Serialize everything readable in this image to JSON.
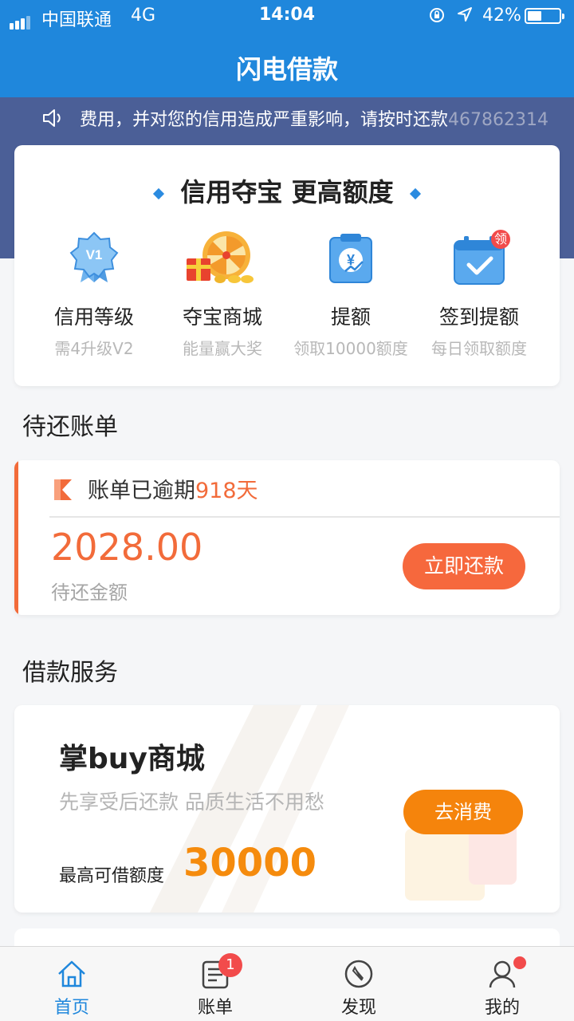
{
  "status_bar": {
    "carrier": "中国联通",
    "network": "4G",
    "time": "14:04",
    "battery": "42%"
  },
  "header": {
    "title": "闪电借款"
  },
  "notice": {
    "text": "费用，并对您的信用造成严重影响，请按时还款",
    "trail": "467862314"
  },
  "promo": {
    "title": "信用夺宝 更高额度",
    "items": [
      {
        "label": "信用等级",
        "sub": "需4升级V2",
        "icon": "v1-badge-icon"
      },
      {
        "label": "夺宝商城",
        "sub": "能量赢大奖",
        "icon": "lucky-wheel-icon"
      },
      {
        "label": "提额",
        "sub": "领取10000额度",
        "icon": "yuan-clipboard-icon"
      },
      {
        "label": "签到提额",
        "sub": "每日领取额度",
        "icon": "calendar-check-icon",
        "badge": "领"
      }
    ]
  },
  "bills": {
    "heading": "待还账单",
    "status_prefix": "账单已逾期",
    "overdue_days": "918天",
    "amount": "2028.00",
    "amount_label": "待还金额",
    "pay_button": "立即还款"
  },
  "loan": {
    "heading": "借款服务",
    "name": "掌buy商城",
    "desc": "先享受后还款 品质生活不用愁",
    "limit_label": "最高可借额度",
    "limit": "30000",
    "button": "去消费"
  },
  "tabs": [
    {
      "label": "首页",
      "icon": "home-icon",
      "active": true
    },
    {
      "label": "账单",
      "icon": "bill-icon",
      "badge": "1"
    },
    {
      "label": "发现",
      "icon": "compass-icon"
    },
    {
      "label": "我的",
      "icon": "user-icon"
    }
  ],
  "colors": {
    "primary": "#1f87dc",
    "band": "#4b5f97",
    "overdue": "#f26b3a",
    "loan_accent": "#f5840c"
  }
}
